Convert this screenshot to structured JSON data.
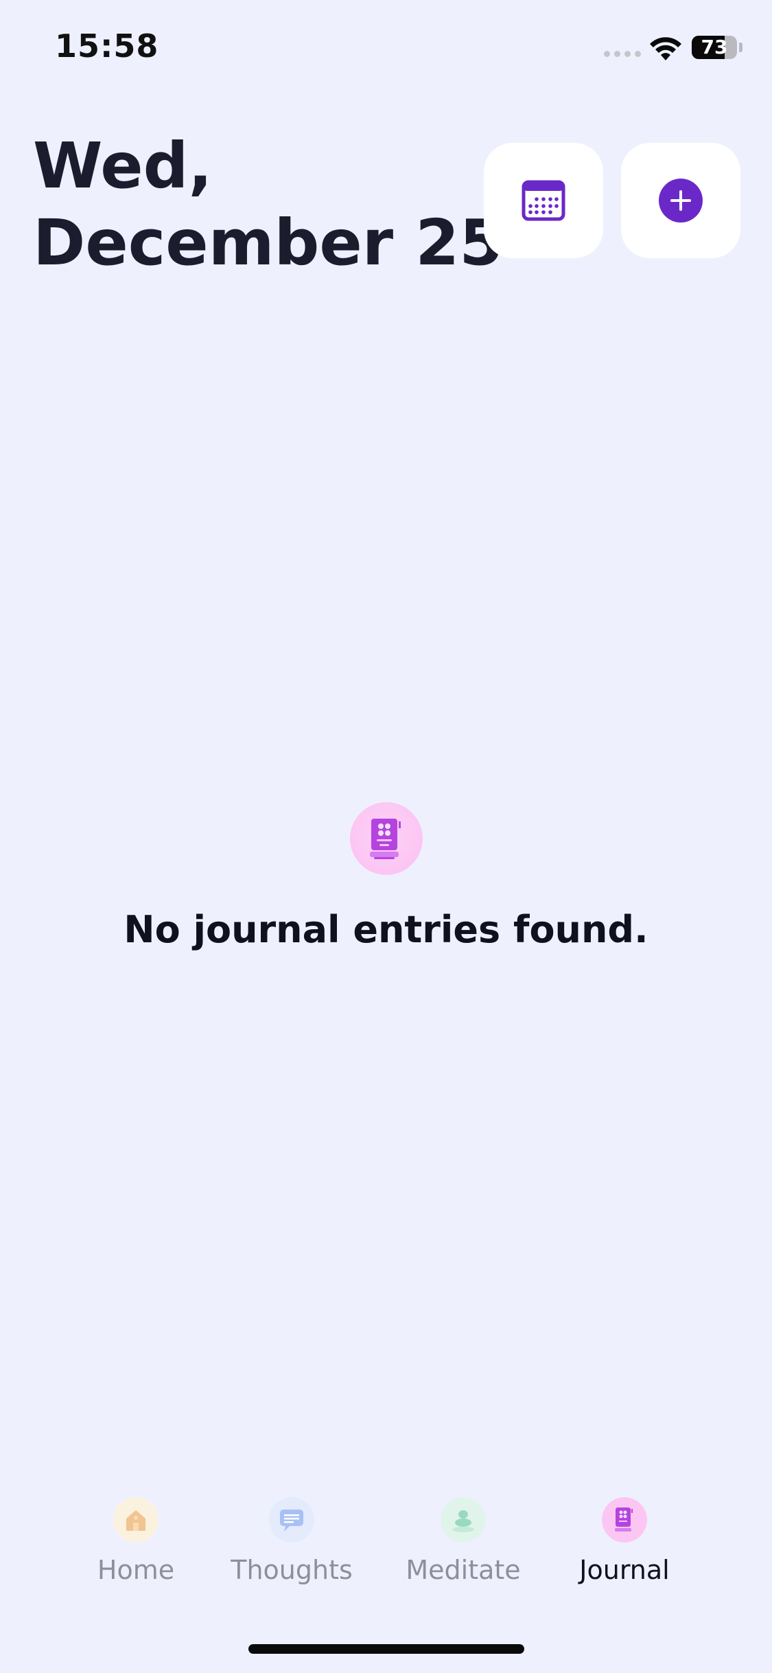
{
  "status_bar": {
    "time": "15:58",
    "battery_percent": "73",
    "battery_level": 0.73
  },
  "header": {
    "date_line1": "Wed,",
    "date_line2": "December 25",
    "calendar_icon": "calendar-icon",
    "add_icon": "plus-circle-icon"
  },
  "empty_state": {
    "icon": "journal-book-icon",
    "message": "No journal entries found."
  },
  "tabs": [
    {
      "label": "Home",
      "icon": "home-icon",
      "active": false
    },
    {
      "label": "Thoughts",
      "icon": "chat-bubble-icon",
      "active": false
    },
    {
      "label": "Meditate",
      "icon": "stones-icon",
      "active": false
    },
    {
      "label": "Journal",
      "icon": "journal-book-icon",
      "active": true
    }
  ],
  "colors": {
    "background": "#eef1fd",
    "accent_purple": "#6b28c8",
    "text_dark": "#1b1d2e",
    "tab_inactive": "#8e8f99"
  }
}
